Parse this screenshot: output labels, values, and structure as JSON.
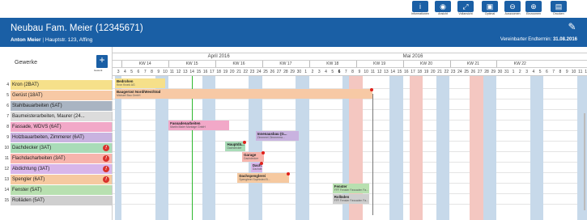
{
  "toolbar": {
    "buttons": [
      {
        "label": "Informationen",
        "icon": "info-icon"
      },
      {
        "label": "Ansicht",
        "icon": "eye-icon"
      },
      {
        "label": "Vollansicht",
        "icon": "fullscreen-icon"
      },
      {
        "label": "Optimal",
        "icon": "fit-icon"
      },
      {
        "label": "Auszoomen",
        "icon": "zoom-out-icon"
      },
      {
        "label": "Einzoomen",
        "icon": "zoom-in-icon"
      },
      {
        "label": "Drucken",
        "icon": "print-icon"
      }
    ]
  },
  "header": {
    "title": "Neubau Fam. Meier (12345671)",
    "client": "Anton Meier",
    "address": "Hauptstr. 123, Affing",
    "deadline_label": "Vereinbarter Endtermin:",
    "deadline_value": "31.08.2016"
  },
  "trades": {
    "title": "Gewerke",
    "add_label": "Gewerk",
    "rows": [
      {
        "num": "4",
        "label": "Kron (2BAT)",
        "color": "#f6e08a",
        "warn": false
      },
      {
        "num": "5",
        "label": "Gerüst (18AT)",
        "color": "#f7c9a5",
        "warn": false
      },
      {
        "num": "6",
        "label": "Stahlbauarbeiten (5AT)",
        "color": "#a9b4c2",
        "warn": false
      },
      {
        "num": "7",
        "label": "Baumeisterarbeiten, Maurer (24...",
        "color": "#dcdcdc",
        "warn": false
      },
      {
        "num": "8",
        "label": "Fassade, WDVS (6AT)",
        "color": "#f2a8c8",
        "warn": false
      },
      {
        "num": "9",
        "label": "Holzbauarbeiten, Zimmerer (6AT)",
        "color": "#c9b3e0",
        "warn": false
      },
      {
        "num": "10",
        "label": "Dachdecker (3AT)",
        "color": "#a9dcb8",
        "warn": true
      },
      {
        "num": "11",
        "label": "Flachdacharbeiten (3AT)",
        "color": "#f7b5ad",
        "warn": true
      },
      {
        "num": "12",
        "label": "Abdichtung (3AT)",
        "color": "#d8b6ea",
        "warn": true
      },
      {
        "num": "13",
        "label": "Spengler (6AT)",
        "color": "#f6c9a0",
        "warn": true
      },
      {
        "num": "14",
        "label": "Fenster (5AT)",
        "color": "#b8e0b0",
        "warn": false
      },
      {
        "num": "15",
        "label": "Rolläden (5AT)",
        "color": "#cfcfcf",
        "warn": false
      }
    ]
  },
  "calendar": {
    "months": [
      "April 2016",
      "Mai 2016"
    ],
    "weeks": [
      "KW 14",
      "KW 15",
      "KW 16",
      "KW 17",
      "KW 18",
      "KW 19",
      "KW 20",
      "KW 21",
      "KW 22"
    ],
    "days": [
      "3",
      "4",
      "5",
      "6",
      "7",
      "8",
      "9",
      "10",
      "11",
      "12",
      "13",
      "14",
      "15",
      "16",
      "17",
      "18",
      "19",
      "20",
      "21",
      "22",
      "23",
      "24",
      "25",
      "26",
      "27",
      "28",
      "29",
      "30",
      "1",
      "2",
      "3",
      "4",
      "5",
      "6",
      "7",
      "8",
      "9",
      "10",
      "11",
      "12",
      "13",
      "14",
      "15",
      "16",
      "17",
      "18",
      "19",
      "20",
      "21",
      "22",
      "23",
      "24",
      "25",
      "26",
      "27",
      "28",
      "29",
      "30",
      "31",
      "1",
      "2",
      "3",
      "4",
      "5",
      "6",
      "7",
      "8",
      "9",
      "10",
      "11",
      "12",
      "13",
      "14",
      "15",
      "16",
      "17",
      "18",
      "19",
      "20",
      "21",
      "22",
      "23",
      "24",
      "25",
      "26",
      "27",
      "28",
      "29",
      "30"
    ],
    "today_day": "6"
  },
  "tasks": [
    {
      "title": "Bedrohen",
      "sub": "Kron Kronk AG"
    },
    {
      "title": "Baugerüst Nord/West/Süd",
      "sub": "Michael Bau GmbH"
    },
    {
      "title": "Fassadenarbeiten",
      "sub": "Martin Maier Montage GmbH"
    },
    {
      "title": "Innenausbau (G...",
      "sub": "Zimmerei Zimmerma..."
    },
    {
      "title": "Hauptdä...",
      "sub": "Dachdecker"
    },
    {
      "title": "Garage",
      "sub": "Dachdecker"
    },
    {
      "title": "Dach...",
      "sub": "Dachde..."
    },
    {
      "title": "Dachspenglerei",
      "sub": "Spenglerei Sophisted B..."
    },
    {
      "title": "Fenster",
      "sub": "FFF Fenster Fassaden Fa..."
    },
    {
      "title": "Rolläden",
      "sub": "FFF Fenster Fassaden Fa..."
    }
  ]
}
